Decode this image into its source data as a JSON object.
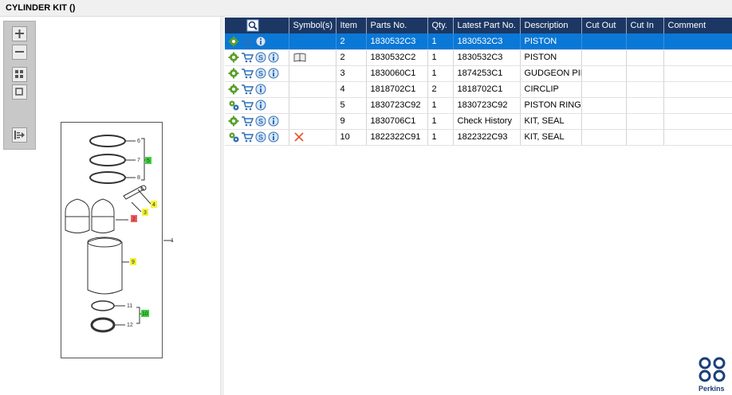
{
  "window": {
    "title": "CYLINDER KIT ()"
  },
  "columns": [
    "Symbol(s)",
    "Item",
    "Parts No.",
    "Qty.",
    "Latest Part No.",
    "Description",
    "Cut Out",
    "Cut In",
    "Comment"
  ],
  "rows": [
    {
      "icons": [
        "gear-icon",
        "cart-icon",
        "info-icon"
      ],
      "symbol": "",
      "item": "2",
      "part_no": "1830532C3",
      "qty": "1",
      "latest": "1830532C3",
      "description": "PISTON",
      "cut_out": "",
      "cut_in": "",
      "comment": ""
    },
    {
      "icons": [
        "gear-icon",
        "cart-icon",
        "supersede-icon",
        "info-icon"
      ],
      "symbol": "book-icon",
      "item": "2",
      "part_no": "1830532C2",
      "qty": "1",
      "latest": "1830532C3",
      "description": "PISTON",
      "cut_out": "",
      "cut_in": "",
      "comment": ""
    },
    {
      "icons": [
        "gear-icon",
        "cart-icon",
        "supersede-icon",
        "info-icon"
      ],
      "symbol": "",
      "item": "3",
      "part_no": "1830060C1",
      "qty": "1",
      "latest": "1874253C1",
      "description": "GUDGEON PIN",
      "cut_out": "",
      "cut_in": "",
      "comment": ""
    },
    {
      "icons": [
        "gear-icon",
        "cart-icon",
        "info-icon"
      ],
      "symbol": "",
      "item": "4",
      "part_no": "1818702C1",
      "qty": "2",
      "latest": "1818702C1",
      "description": "CIRCLIP",
      "cut_out": "",
      "cut_in": "",
      "comment": ""
    },
    {
      "icons": [
        "multi-gear-icon",
        "cart-icon",
        "info-icon"
      ],
      "symbol": "",
      "item": "5",
      "part_no": "1830723C92",
      "qty": "1",
      "latest": "1830723C92",
      "description": "PISTON RING",
      "cut_out": "",
      "cut_in": "",
      "comment": ""
    },
    {
      "icons": [
        "gear-icon",
        "cart-icon",
        "supersede-icon",
        "info-icon"
      ],
      "symbol": "",
      "item": "9",
      "part_no": "1830706C1",
      "qty": "1",
      "latest": "Check History",
      "description": "KIT, SEAL",
      "cut_out": "",
      "cut_in": "",
      "comment": ""
    },
    {
      "icons": [
        "multi-gear-icon",
        "cart-icon",
        "supersede-icon",
        "info-icon"
      ],
      "symbol": "cross-icon",
      "item": "10",
      "part_no": "1822322C91",
      "qty": "1",
      "latest": "1822322C93",
      "description": "KIT, SEAL",
      "cut_out": "",
      "cut_in": "",
      "comment": ""
    }
  ],
  "drawing": {
    "callouts": [
      "6",
      "7",
      "8",
      "4",
      "3",
      "2",
      "9",
      "11",
      "12",
      "1"
    ],
    "tags": [
      "5",
      "10"
    ]
  },
  "brand": {
    "logo_text": "Perkins",
    "color": "#1c3e7a"
  },
  "colors": {
    "header": "#1c3763",
    "selected_row": "#0a78d7",
    "accent_green": "#5aa02c"
  }
}
